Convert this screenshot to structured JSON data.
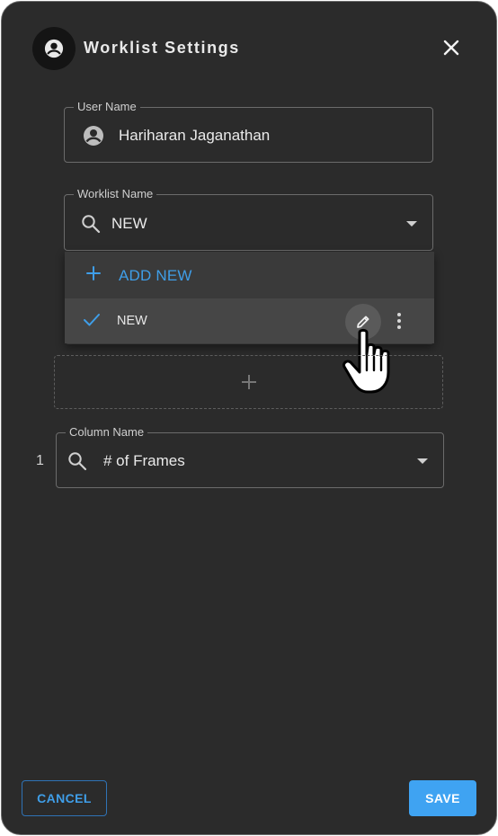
{
  "dialog": {
    "title": "Worklist Settings"
  },
  "user_name_field": {
    "label": "User Name",
    "value": "Hariharan Jaganathan"
  },
  "worklist_name_field": {
    "label": "Worklist Name",
    "value": "NEW"
  },
  "worklist_menu": {
    "add_label": "ADD NEW",
    "items": [
      {
        "label": "NEW",
        "selected": true
      }
    ]
  },
  "columns": [
    {
      "index": "1",
      "label": "Column Name",
      "value": "# of Frames"
    }
  ],
  "footer": {
    "cancel_label": "CANCEL",
    "save_label": "SAVE"
  },
  "colors": {
    "background": "#2b2b2b",
    "accent": "#3f9ee8",
    "save_button": "#3fa3f2"
  },
  "icons": [
    "account-circle-icon",
    "close-icon",
    "search-icon",
    "dropdown-arrow-icon",
    "plus-icon",
    "check-icon",
    "pencil-icon",
    "more-vertical-icon",
    "hand-cursor-icon"
  ]
}
